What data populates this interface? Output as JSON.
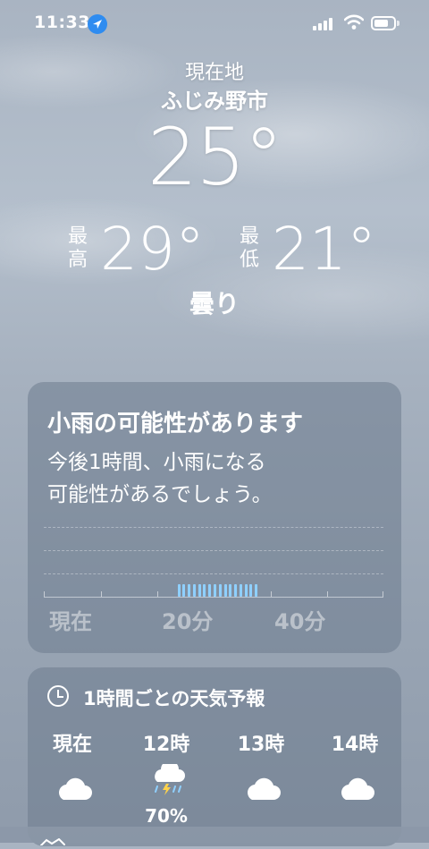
{
  "status_bar": {
    "time": "11:33",
    "icons": [
      "location-arrow-icon",
      "signal-icon",
      "wifi-icon",
      "battery-icon"
    ]
  },
  "header": {
    "location_label": "現在地",
    "city": "ふじみ野市",
    "temperature": "25°",
    "high_label": "最高",
    "high_value": "29°",
    "low_label": "最低",
    "low_value": "21°",
    "condition": "曇り"
  },
  "rain_card": {
    "title": "小雨の可能性があります",
    "description_line1": "今後1時間、小雨になる",
    "description_line2": "可能性があるでしょう。",
    "x_labels": [
      "現在",
      "20分",
      "40分"
    ],
    "chart_data": {
      "type": "bar",
      "series": [
        {
          "values": [
            0,
            0,
            0,
            0,
            0,
            0,
            0,
            0,
            0,
            0,
            0,
            0,
            0,
            0,
            0,
            0,
            0,
            0,
            0,
            0,
            0,
            0,
            0,
            0,
            0,
            0,
            0,
            0,
            0,
            0,
            0,
            0,
            0,
            0,
            0,
            0,
            0,
            0,
            0,
            0,
            0,
            0,
            0,
            0,
            0,
            0,
            0,
            0,
            0,
            0,
            0,
            0,
            0,
            0,
            0,
            0,
            0,
            0,
            0,
            0,
            0,
            0,
            0,
            0,
            0,
            0,
            0,
            0,
            0,
            0,
            0,
            0,
            0,
            0,
            0,
            0,
            0,
            0,
            1,
            1,
            1,
            1,
            1,
            1,
            1,
            1,
            1,
            1,
            1,
            1,
            1,
            1,
            1,
            1,
            1,
            1,
            1,
            1,
            1,
            1,
            1,
            1,
            1,
            1,
            1,
            1,
            1,
            1,
            1,
            1,
            1,
            1,
            1,
            1,
            1,
            1,
            1,
            1,
            1,
            1,
            1,
            1,
            1,
            1,
            1,
            1,
            0,
            0,
            0,
            0,
            0,
            0,
            0,
            0,
            0,
            0,
            0,
            0,
            0,
            0,
            0,
            0,
            0,
            0,
            0,
            0,
            0,
            0,
            0,
            0,
            0,
            0,
            0,
            0,
            0,
            0,
            0,
            0,
            0,
            0,
            0,
            0,
            0,
            0,
            0,
            0,
            0,
            0,
            0,
            0,
            0,
            0,
            0,
            0,
            0,
            0,
            0,
            0,
            0,
            0,
            0,
            0,
            0,
            0,
            0,
            0,
            0,
            0,
            0,
            0,
            0,
            0,
            0,
            0,
            0,
            0,
            0,
            0
          ]
        }
      ],
      "accent": "#8fd0ff"
    }
  },
  "hourly_card": {
    "title": "1時間ごとの天気予報",
    "hours": [
      {
        "label": "現在",
        "icon": "cloud-icon",
        "precip": ""
      },
      {
        "label": "12時",
        "icon": "thunderstorm-icon",
        "precip": "70%"
      },
      {
        "label": "13時",
        "icon": "cloud-icon",
        "precip": ""
      },
      {
        "label": "14時",
        "icon": "cloud-icon",
        "precip": ""
      }
    ]
  }
}
